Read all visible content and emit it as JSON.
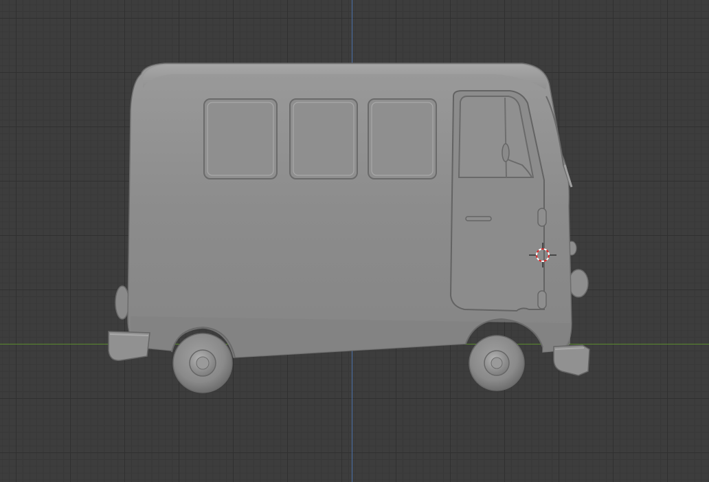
{
  "viewport": {
    "background_color": "#3d3d3d",
    "grid_major_color": "#303030",
    "grid_minor_color": "#383838",
    "x_axis_color": "#5b8a2e",
    "y_axis_color": "#4a6fa8"
  },
  "model": {
    "icon": "van-mesh-icon",
    "body_color": "#8e8e8e",
    "shade_color": "#6a6a6a",
    "highlight_color": "#a6a6a6"
  },
  "cursor_3d": {
    "icon": "3d-cursor-icon",
    "ring_color_a": "#e02828",
    "ring_color_b": "#ffffff"
  }
}
